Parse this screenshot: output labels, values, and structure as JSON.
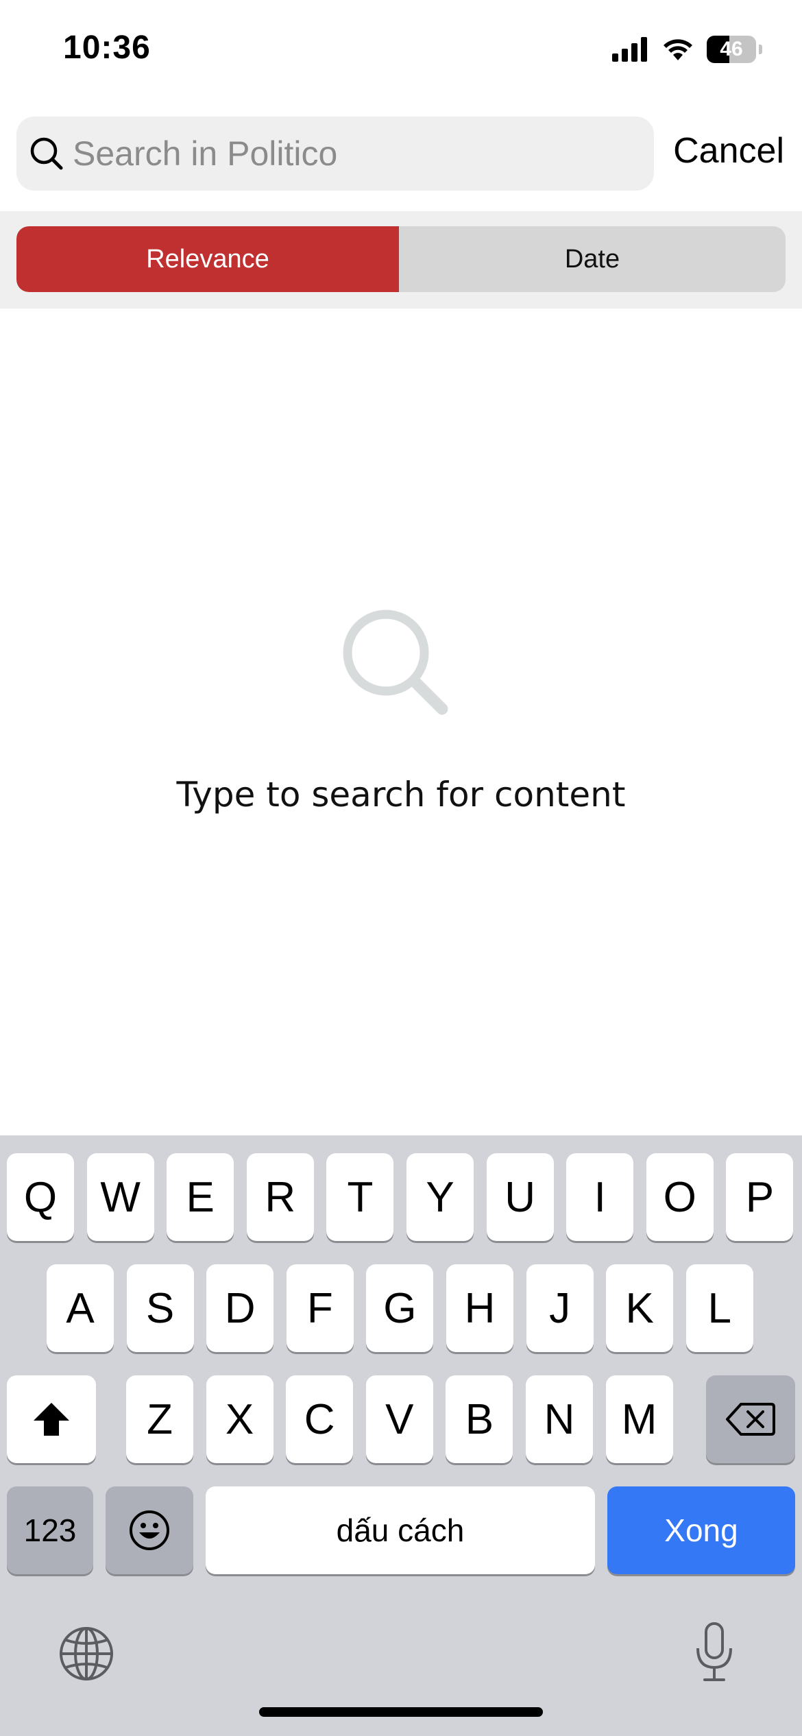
{
  "status_bar": {
    "time": "10:36",
    "battery": "46",
    "battery_level": 0.46
  },
  "search": {
    "placeholder": "Search in Politico",
    "value": "",
    "cancel_label": "Cancel"
  },
  "sort": {
    "options": [
      "Relevance",
      "Date"
    ],
    "selected": "Relevance",
    "accent_color": "#c13030"
  },
  "empty_state": {
    "icon": "magnifier-icon",
    "message": "Type to search for content"
  },
  "keyboard": {
    "row1": [
      "Q",
      "W",
      "E",
      "R",
      "T",
      "Y",
      "U",
      "I",
      "O",
      "P"
    ],
    "row2": [
      "A",
      "S",
      "D",
      "F",
      "G",
      "H",
      "J",
      "K",
      "L"
    ],
    "row3": [
      "Z",
      "X",
      "C",
      "V",
      "B",
      "N",
      "M"
    ],
    "numbers_label": "123",
    "space_label": "dấu cách",
    "return_label": "Xong",
    "return_color": "#3478f6"
  }
}
